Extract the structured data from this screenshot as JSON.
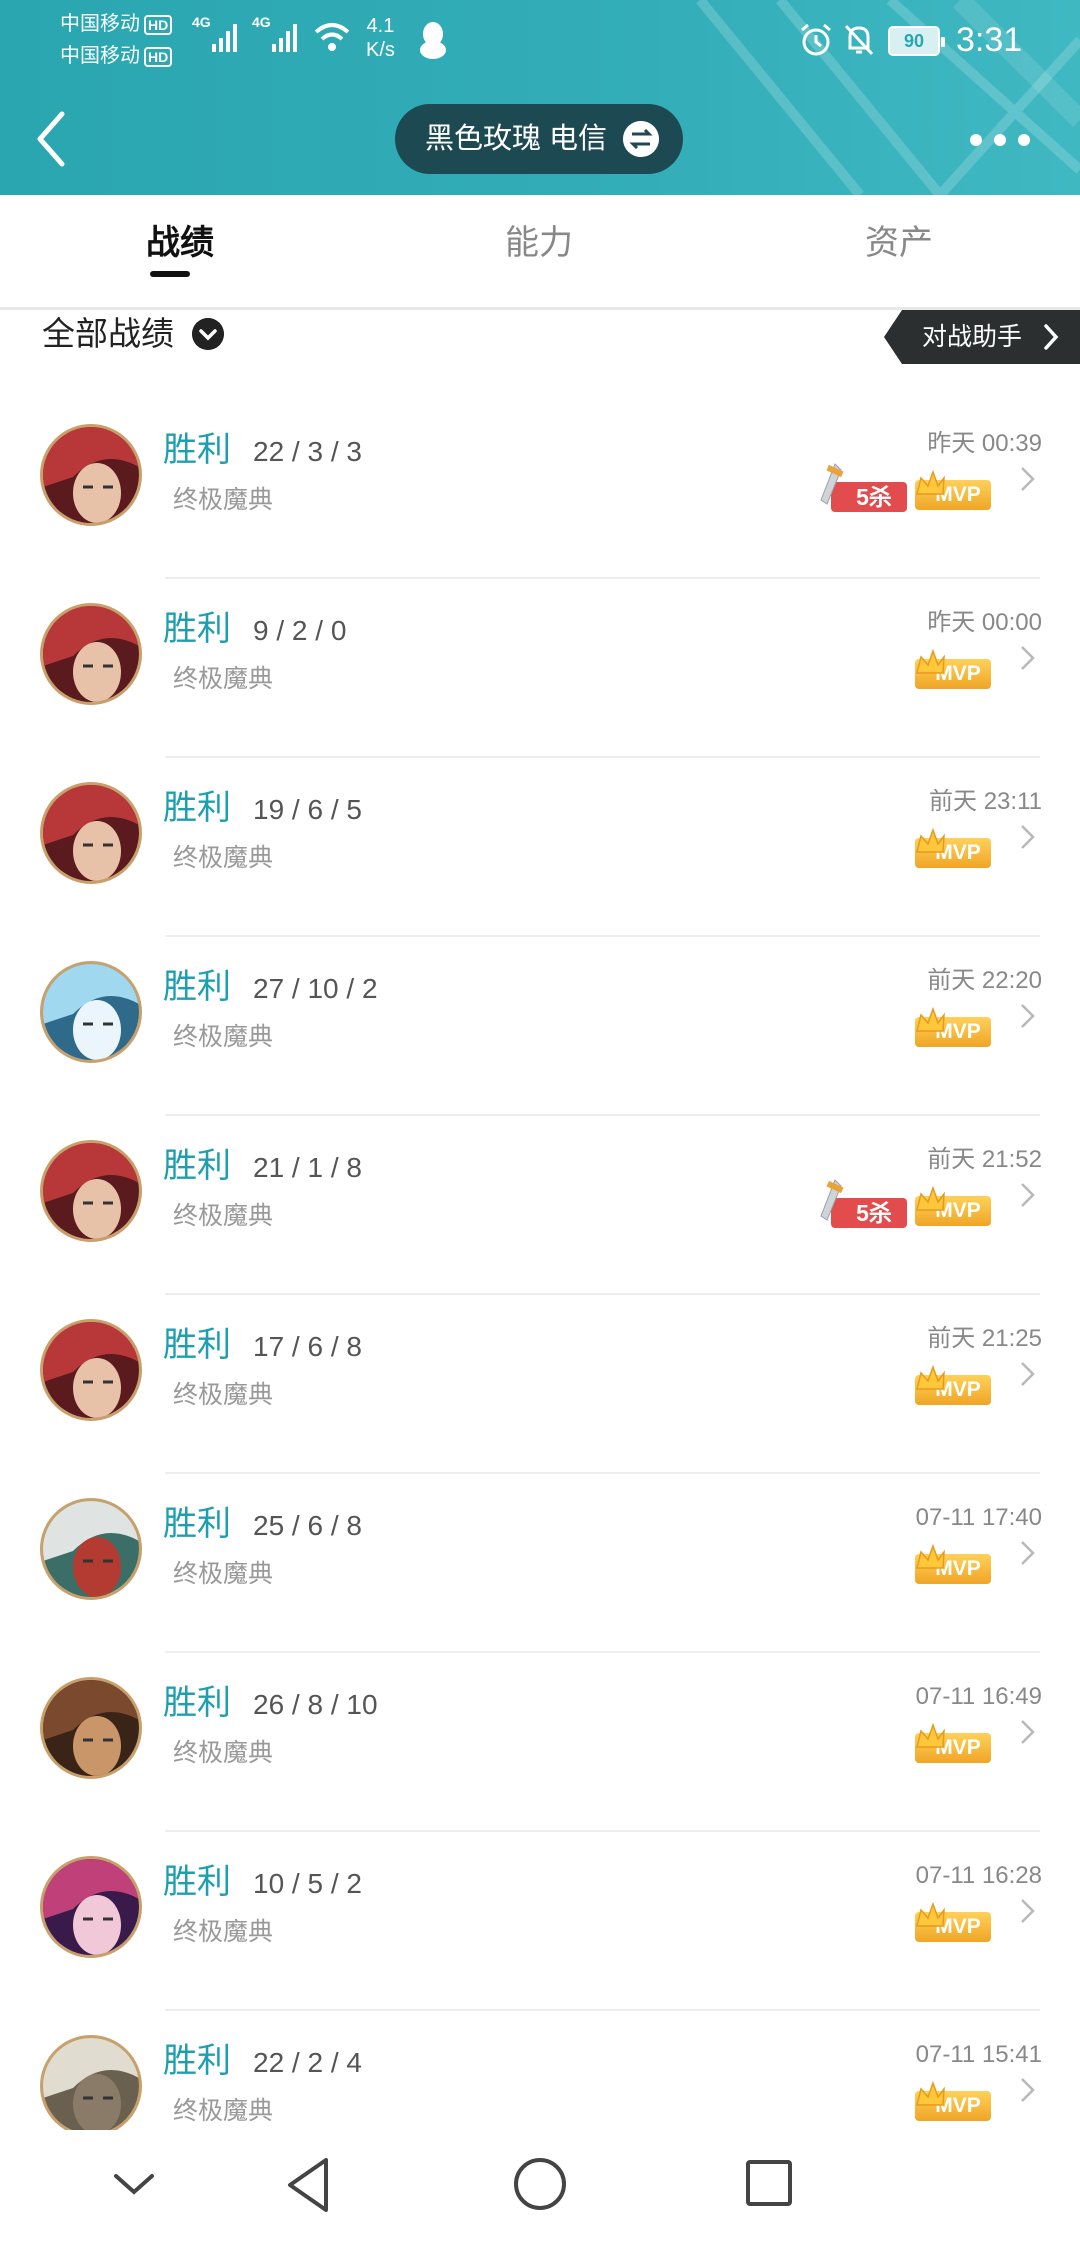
{
  "status_bar": {
    "carrier1": "中国移动",
    "carrier2": "中国移动",
    "hd": "HD",
    "net_label": "4G",
    "speed_value": "4.1",
    "speed_unit": "K/s",
    "battery": "90",
    "time": "3:31"
  },
  "header": {
    "account_name": "黑色玫瑰 电信"
  },
  "tabs": [
    {
      "label": "战绩"
    },
    {
      "label": "能力"
    },
    {
      "label": "资产"
    }
  ],
  "filter": {
    "label": "全部战绩",
    "assistant_label": "对战助手"
  },
  "matches": [
    {
      "result": "胜利",
      "kda": "22 / 3 / 3",
      "mode": "终极魔典",
      "time": "昨天 00:39",
      "penta": true,
      "mvp": true,
      "avatar": "hero-red"
    },
    {
      "result": "胜利",
      "kda": "9 / 2 / 0",
      "mode": "终极魔典",
      "time": "昨天 00:00",
      "penta": false,
      "mvp": true,
      "avatar": "hero-red"
    },
    {
      "result": "胜利",
      "kda": "19 / 6 / 5",
      "mode": "终极魔典",
      "time": "前天 23:11",
      "penta": false,
      "mvp": true,
      "avatar": "hero-red"
    },
    {
      "result": "胜利",
      "kda": "27 / 10 / 2",
      "mode": "终极魔典",
      "time": "前天 22:20",
      "penta": false,
      "mvp": true,
      "avatar": "hero-ice"
    },
    {
      "result": "胜利",
      "kda": "21 / 1 / 8",
      "mode": "终极魔典",
      "time": "前天 21:52",
      "penta": true,
      "mvp": true,
      "avatar": "hero-red"
    },
    {
      "result": "胜利",
      "kda": "17 / 6 / 8",
      "mode": "终极魔典",
      "time": "前天 21:25",
      "penta": false,
      "mvp": true,
      "avatar": "hero-red"
    },
    {
      "result": "胜利",
      "kda": "25 / 6 / 8",
      "mode": "终极魔典",
      "time": "07-11 17:40",
      "penta": false,
      "mvp": true,
      "avatar": "hero-white"
    },
    {
      "result": "胜利",
      "kda": "26 / 8 / 10",
      "mode": "终极魔典",
      "time": "07-11 16:49",
      "penta": false,
      "mvp": true,
      "avatar": "hero-dark"
    },
    {
      "result": "胜利",
      "kda": "10 / 5 / 2",
      "mode": "终极魔典",
      "time": "07-11 16:28",
      "penta": false,
      "mvp": true,
      "avatar": "hero-purple"
    },
    {
      "result": "胜利",
      "kda": "22 / 2 / 4",
      "mode": "终极魔典",
      "time": "07-11 15:41",
      "penta": false,
      "mvp": true,
      "avatar": "hero-pale"
    }
  ],
  "badges": {
    "penta_label": "5杀",
    "mvp_label": "MVP"
  },
  "colors": {
    "header": "#2aa6b0",
    "win": "#1e9fb0",
    "pill": "#1d4a52",
    "mvp": "#f0a526",
    "penta": "#e34c4c"
  }
}
